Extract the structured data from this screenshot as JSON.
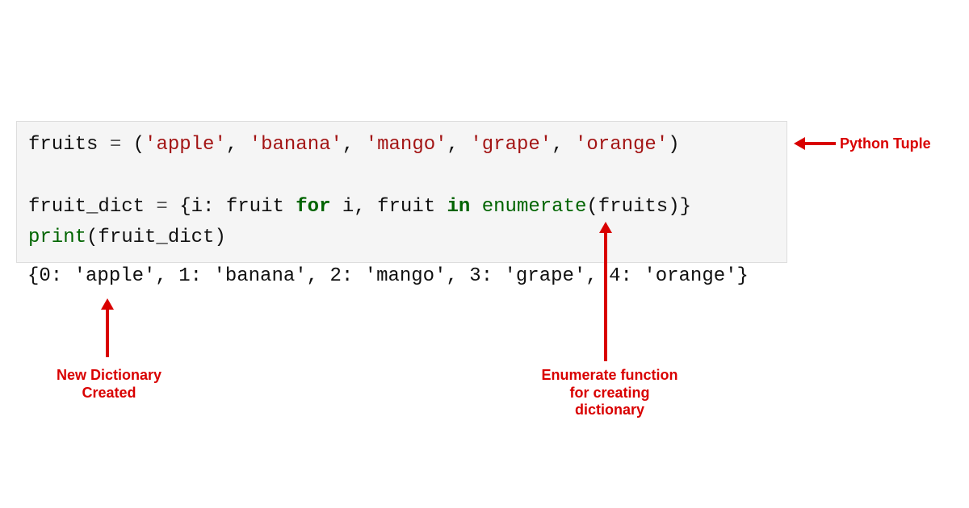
{
  "code": {
    "line1": {
      "var": "fruits",
      "eq": " = ",
      "open": "(",
      "s1": "'apple'",
      "c1": ", ",
      "s2": "'banana'",
      "c2": ", ",
      "s3": "'mango'",
      "c3": ", ",
      "s4": "'grape'",
      "c4": ", ",
      "s5": "'orange'",
      "close": ")"
    },
    "blank": " ",
    "line2": {
      "var": "fruit_dict",
      "eq": " = ",
      "open": "{i: fruit ",
      "for": "for",
      "mid": " i, fruit ",
      "in": "in",
      "sp": " ",
      "enum": "enumerate",
      "args": "(fruits)}"
    },
    "line3": {
      "print": "print",
      "args": "(fruit_dict)"
    }
  },
  "output": {
    "text": "{0: 'apple', 1: 'banana', 2: 'mango', 3: 'grape', 4: 'orange'}"
  },
  "annotations": {
    "tuple": "Python Tuple",
    "enumerate_l1": "Enumerate function",
    "enumerate_l2": "for creating",
    "enumerate_l3": "dictionary",
    "newdict_l1": "New Dictionary",
    "newdict_l2": "Created"
  }
}
